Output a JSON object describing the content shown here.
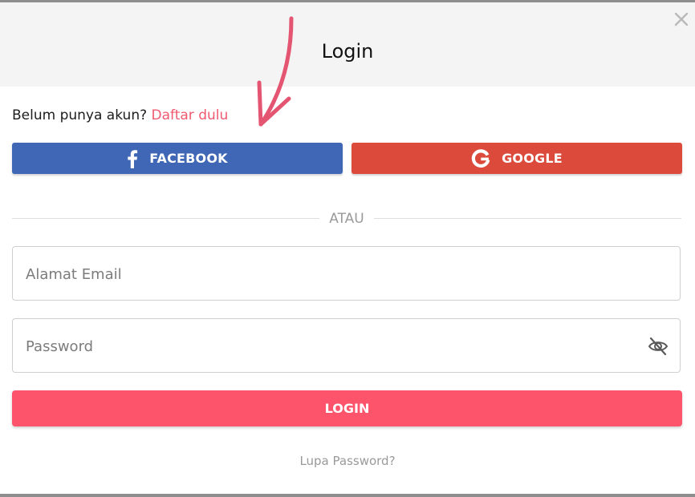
{
  "header": {
    "title": "Login"
  },
  "signup": {
    "prompt": "Belum punya akun?",
    "link_label": "Daftar dulu"
  },
  "social": {
    "facebook_label": "FACEBOOK",
    "google_label": "GOOGLE"
  },
  "divider": {
    "text": "ATAU"
  },
  "form": {
    "email_placeholder": "Alamat Email",
    "email_value": "",
    "password_placeholder": "Password",
    "password_value": "",
    "login_label": "LOGIN"
  },
  "footer": {
    "forgot_label": "Lupa Password?"
  },
  "icons": {
    "close": "close-icon",
    "facebook": "facebook-icon",
    "google": "google-icon",
    "eye_off": "eye-off-icon",
    "annotation_arrow": "arrow-icon"
  },
  "colors": {
    "accent": "#fd546b",
    "link": "#ef5a6f",
    "facebook": "#4067b5",
    "google": "#db4a3b",
    "header_bg": "#f4f4f4"
  }
}
